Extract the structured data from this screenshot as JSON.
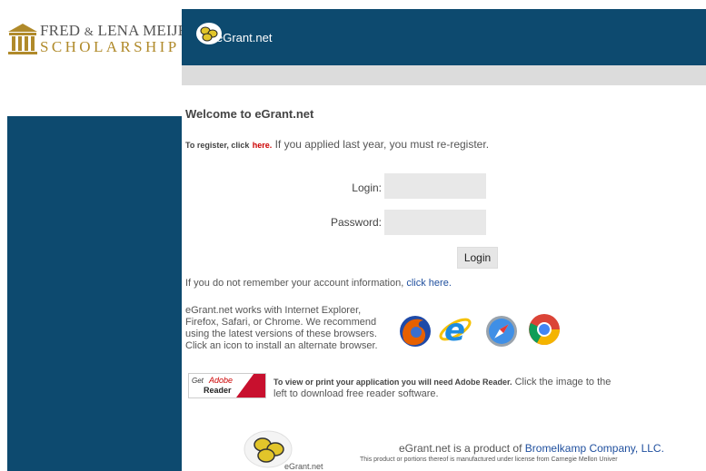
{
  "header": {
    "org_name_top": "FRED & LENA MEIJER",
    "org_name_top_a": "FRED",
    "org_name_top_amp": "&",
    "org_name_top_b": "LENA MEIJER",
    "org_name_bottom": "SCHOLARSHIP",
    "app_name": "eGrant.net",
    "bar_color": "#0d4a6f"
  },
  "main": {
    "welcome": "Welcome to eGrant.net",
    "register_prefix": "To register, click",
    "register_link": "here.",
    "register_suffix": "If you applied last year, you must re-register.",
    "login_label": "Login:",
    "password_label": "Password:",
    "login_value": "",
    "password_value": "",
    "login_button": "Login",
    "forgot_prefix": "If you do not remember your account information,",
    "forgot_link": "click here.",
    "browsers_text": "eGrant.net works with Internet Explorer, Firefox, Safari, or Chrome. We recommend using the latest versions of these browsers. Click an icon to install an alternate browser.",
    "browser_icons": [
      "firefox-icon",
      "internet-explorer-icon",
      "safari-icon",
      "chrome-icon"
    ],
    "adobe_badge_get": "Get Adobe",
    "adobe_badge_reader": "Reader",
    "reader_bold": "To view or print your application you will need Adobe Reader.",
    "reader_rest": "Click the image to the left to download free reader software."
  },
  "footer": {
    "logo_text": "eGrant.net",
    "product_prefix": "eGrant.net is a product of",
    "product_link": "Bromelkamp Company, LLC.",
    "license_text": "This product or portions thereof is manufactured under license from Carnegie Mellon Univer"
  }
}
